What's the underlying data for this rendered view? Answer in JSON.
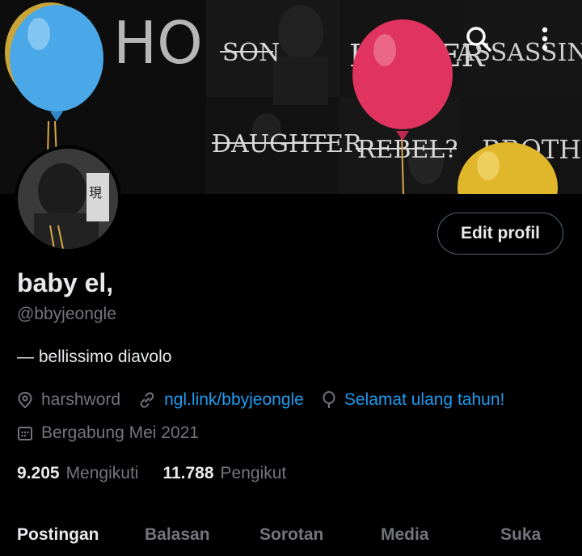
{
  "banner": {
    "words": [
      "HO",
      "SON",
      "LEADER",
      "ASSASSIN",
      "DAUGHTER",
      "REBEL?",
      "BROTHER"
    ]
  },
  "header": {
    "search_icon": "search-icon",
    "more_icon": "more-vertical-icon"
  },
  "profile": {
    "avatar_text": "現",
    "edit_label": "Edit profil",
    "name": "baby el,",
    "handle": "@bbyjeongle",
    "bio": "— bellissimo diavolo",
    "location": "harshword",
    "link": "ngl.link/bbyjeongle",
    "birthday": "Selamat ulang tahun!",
    "joined": "Bergabung Mei 2021"
  },
  "stats": {
    "following_count": "9.205",
    "following_label": "Mengikuti",
    "followers_count": "11.788",
    "followers_label": "Pengikut"
  },
  "tabs": [
    "Postingan",
    "Balasan",
    "Sorotan",
    "Media",
    "Suka"
  ],
  "colors": {
    "accent": "#1d9bf0",
    "muted": "#71767b",
    "balloon_blue": "#4aa8e8",
    "balloon_red": "#e0335f",
    "balloon_yellow": "#e0b62a"
  }
}
